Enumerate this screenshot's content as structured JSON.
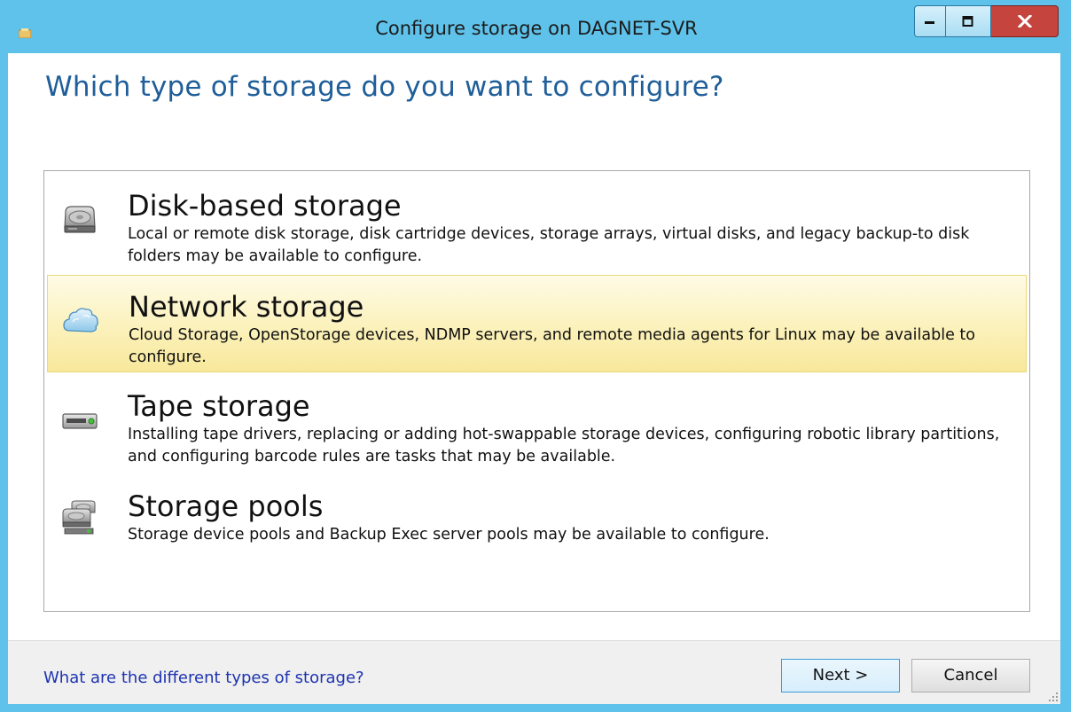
{
  "window": {
    "title": "Configure storage on DAGNET-SVR",
    "accent_color": "#5fc2ea",
    "close_color": "#c5443d"
  },
  "main": {
    "heading": "Which type of storage do you want to configure?",
    "options": [
      {
        "title": "Disk-based storage",
        "description": "Local or remote disk storage, disk cartridge devices, storage arrays, virtual disks, and legacy backup-to disk folders may be available to configure.",
        "icon": "hard-disk-icon",
        "selected": false
      },
      {
        "title": "Network storage",
        "description": "Cloud Storage, OpenStorage devices, NDMP servers, and remote media agents for Linux may be available to configure.",
        "icon": "cloud-icon",
        "selected": true
      },
      {
        "title": "Tape storage",
        "description": "Installing tape drivers, replacing or adding hot-swappable storage devices, configuring robotic library partitions, and configuring barcode rules are tasks that may be available.",
        "icon": "tape-drive-icon",
        "selected": false
      },
      {
        "title": "Storage pools",
        "description": "Storage device pools and Backup Exec server pools may be available to configure.",
        "icon": "storage-pool-icon",
        "selected": false
      }
    ]
  },
  "footer": {
    "help_link": "What are the different types of storage?",
    "next_label": "Next >",
    "cancel_label": "Cancel"
  }
}
